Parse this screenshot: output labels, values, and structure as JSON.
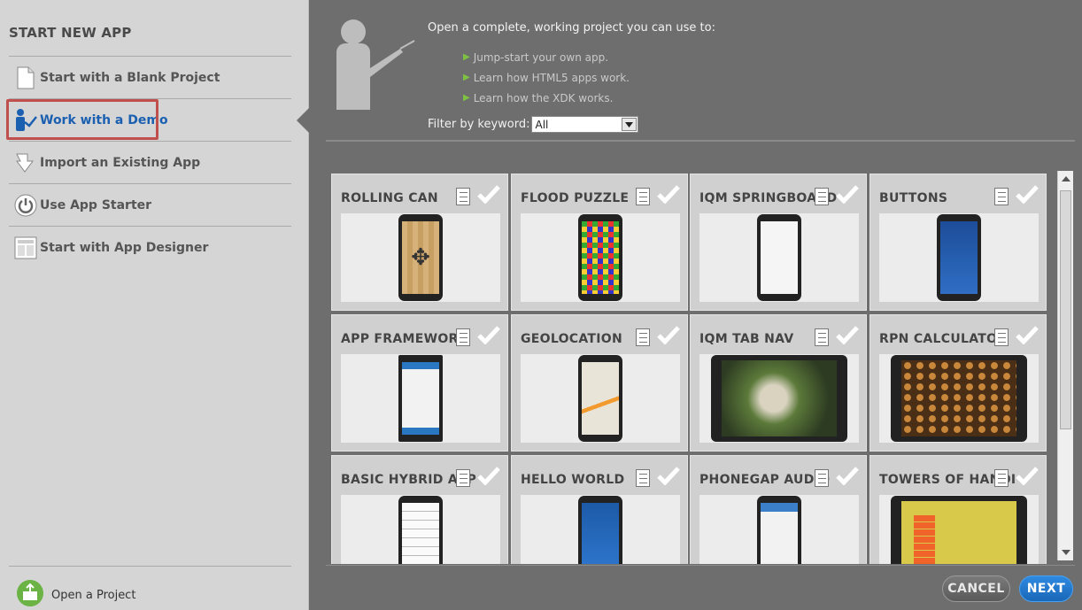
{
  "sidebar": {
    "title": "START NEW APP",
    "items": [
      {
        "label": "Start with a Blank Project",
        "icon": "blank-document-icon"
      },
      {
        "label": "Work with a Demo",
        "icon": "demo-presenter-icon"
      },
      {
        "label": "Import an Existing App",
        "icon": "import-arrow-icon"
      },
      {
        "label": "Use App Starter",
        "icon": "power-icon"
      },
      {
        "label": "Start with App Designer",
        "icon": "designer-icon"
      }
    ],
    "open_project": "Open a Project"
  },
  "main": {
    "intro": "Open a complete, working project you can use to:",
    "bullets": [
      "Jump-start your own app.",
      "Learn how HTML5 apps work.",
      "Learn how the XDK works."
    ],
    "filter_label": "Filter by keyword:",
    "filter_value": "All"
  },
  "demos": [
    {
      "name": "ROLLING CAN"
    },
    {
      "name": "FLOOD PUZZLE"
    },
    {
      "name": "IQM SPRINGBOARD"
    },
    {
      "name": "BUTTONS"
    },
    {
      "name": "APP FRAMEWORK"
    },
    {
      "name": "GEOLOCATION"
    },
    {
      "name": "IQM TAB NAV"
    },
    {
      "name": "RPN CALCULATOR"
    },
    {
      "name": "BASIC HYBRID APP"
    },
    {
      "name": "HELLO WORLD"
    },
    {
      "name": "PHONEGAP AUDIO"
    },
    {
      "name": "TOWERS OF HANOI"
    }
  ],
  "buttons": {
    "cancel": "CANCEL",
    "next": "NEXT"
  },
  "colors": {
    "accent": "#1b5fb0",
    "highlight_box": "#c0504d",
    "bullet": "#7ec242",
    "next_button": "#1a67b8"
  }
}
